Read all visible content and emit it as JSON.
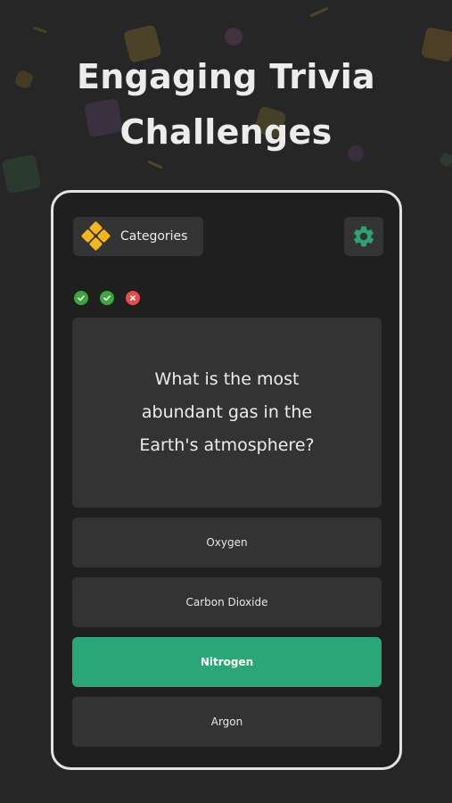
{
  "headline": {
    "line1": "Engaging Trivia",
    "line2": "Challenges"
  },
  "toolbar": {
    "categories_label": "Categories",
    "categories_icon": "four-diamonds-icon",
    "settings_icon": "gear-icon"
  },
  "progress": {
    "results": [
      "correct",
      "correct",
      "wrong"
    ]
  },
  "question": {
    "text": "What is the most abundant gas in the Earth's atmosphere?"
  },
  "answers": [
    {
      "label": "Oxygen",
      "state": "default"
    },
    {
      "label": "Carbon Dioxide",
      "state": "default"
    },
    {
      "label": "Nitrogen",
      "state": "correct"
    },
    {
      "label": "Argon",
      "state": "default"
    }
  ],
  "colors": {
    "background": "#262626",
    "card": "#333333",
    "correct": "#2ba678",
    "accent_yellow": "#f7b614",
    "check_green": "#3aa83d",
    "wrong_red": "#e84b4b",
    "gear_green": "#2fa36f"
  }
}
